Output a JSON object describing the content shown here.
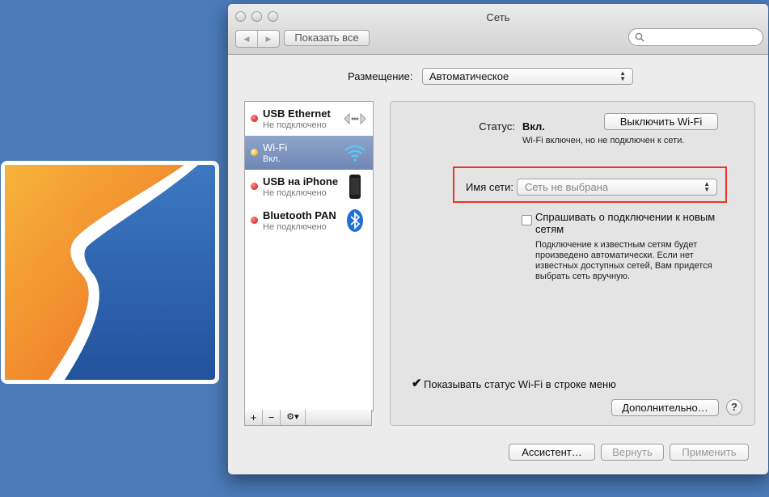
{
  "window": {
    "title": "Сеть"
  },
  "toolbar": {
    "show_all_label": "Показать все",
    "search_placeholder": ""
  },
  "location": {
    "label": "Размещение:",
    "value": "Автоматическое"
  },
  "services": [
    {
      "name": "USB Ethernet",
      "status": "Не подключено",
      "dot": "red",
      "icon": "ethernet-icon",
      "selected": false
    },
    {
      "name": "Wi-Fi",
      "status": "Вкл.",
      "dot": "yellow",
      "icon": "wifi-icon",
      "selected": true
    },
    {
      "name": "USB на iPhone",
      "status": "Не подключено",
      "dot": "red",
      "icon": "iphone-icon",
      "selected": false
    },
    {
      "name": "Bluetooth PAN",
      "status": "Не подключено",
      "dot": "red",
      "icon": "bluetooth-icon",
      "selected": false
    }
  ],
  "list_tools": {
    "add": "+",
    "remove": "−",
    "gear": "⚙▾"
  },
  "detail": {
    "status_label": "Статус:",
    "status_value": "Вкл.",
    "toggle_button": "Выключить Wi-Fi",
    "status_description": "Wi-Fi включен, но не подключен к сети.",
    "network_label": "Имя сети:",
    "network_value": "Сеть не выбрана",
    "ask_checkbox_label": "Спрашивать о подключении к новым сетям",
    "ask_checked": false,
    "ask_description": "Подключение к известным сетям будет произведено автоматически. Если нет известных доступных сетей, Вам придется выбрать сеть вручную.",
    "show_status_label": "Показывать статус Wi-Fi в строке меню",
    "show_status_checked": true,
    "advanced_button": "Дополнительно…",
    "help_button": "?"
  },
  "footer": {
    "assistant": "Ассистент…",
    "revert": "Вернуть",
    "apply": "Применить"
  },
  "colors": {
    "desktop": "#4a7ab8",
    "selection": "#7f96c0",
    "highlight_box": "#e8342a",
    "status_red": "#d01010",
    "status_yellow": "#e0b000"
  }
}
